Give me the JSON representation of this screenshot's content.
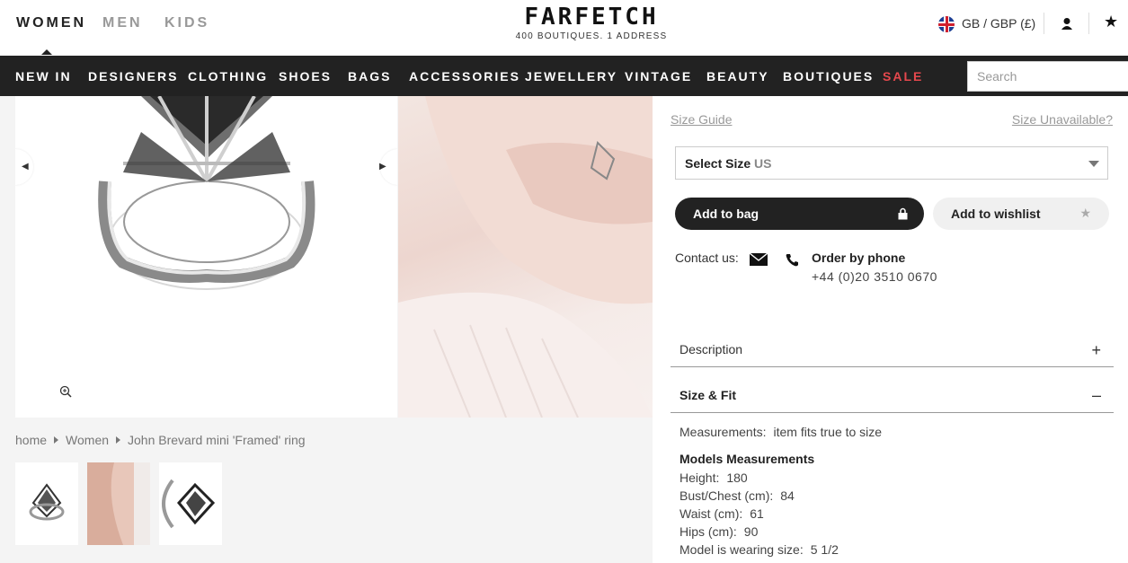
{
  "top": {
    "genders": [
      {
        "label": "WOMEN",
        "active": true
      },
      {
        "label": "MEN",
        "active": false
      },
      {
        "label": "KIDS",
        "active": false
      }
    ],
    "logo": {
      "name": "FARFETCH",
      "tagline": "400 BOUTIQUES. 1 ADDRESS"
    },
    "currency": "GB / GBP (£)",
    "icons": {
      "flag": "uk-flag-icon",
      "account": "user-icon",
      "wishlist": "star-icon"
    }
  },
  "nav": {
    "items": [
      "NEW IN",
      "DESIGNERS",
      "CLOTHING",
      "SHOES",
      "BAGS",
      "ACCESSORIES",
      "JEWELLERY",
      "VINTAGE",
      "BEAUTY",
      "BOUTIQUES",
      "SALE"
    ],
    "sale_color": "#e5484d",
    "search_placeholder": "Search"
  },
  "breadcrumb": [
    "home",
    "Women",
    "John Brevard mini 'Framed' ring"
  ],
  "product": {
    "size_guide": "Size Guide",
    "size_unavailable": "Size Unavailable?",
    "select_size_label": "Select Size",
    "select_size_unit": "US",
    "add_to_bag": "Add to bag",
    "add_to_wishlist": "Add to wishlist",
    "contact_label": "Contact us:",
    "order_by_phone": "Order by phone",
    "phone_number": "+44 (0)20 3510 0670"
  },
  "accordion": {
    "description": {
      "label": "Description",
      "sign": "+"
    },
    "size_fit": {
      "label": "Size & Fit",
      "sign": "–"
    }
  },
  "size_fit": {
    "measurements_label": "Measurements:",
    "measurements_value": "item fits true to size",
    "models_title": "Models Measurements",
    "rows": [
      {
        "label": "Height:",
        "value": "180"
      },
      {
        "label": "Bust/Chest (cm):",
        "value": "84"
      },
      {
        "label": "Waist (cm):",
        "value": "61"
      },
      {
        "label": "Hips (cm):",
        "value": "90"
      },
      {
        "label": "Model is wearing size:",
        "value": "5 1/2"
      }
    ]
  }
}
